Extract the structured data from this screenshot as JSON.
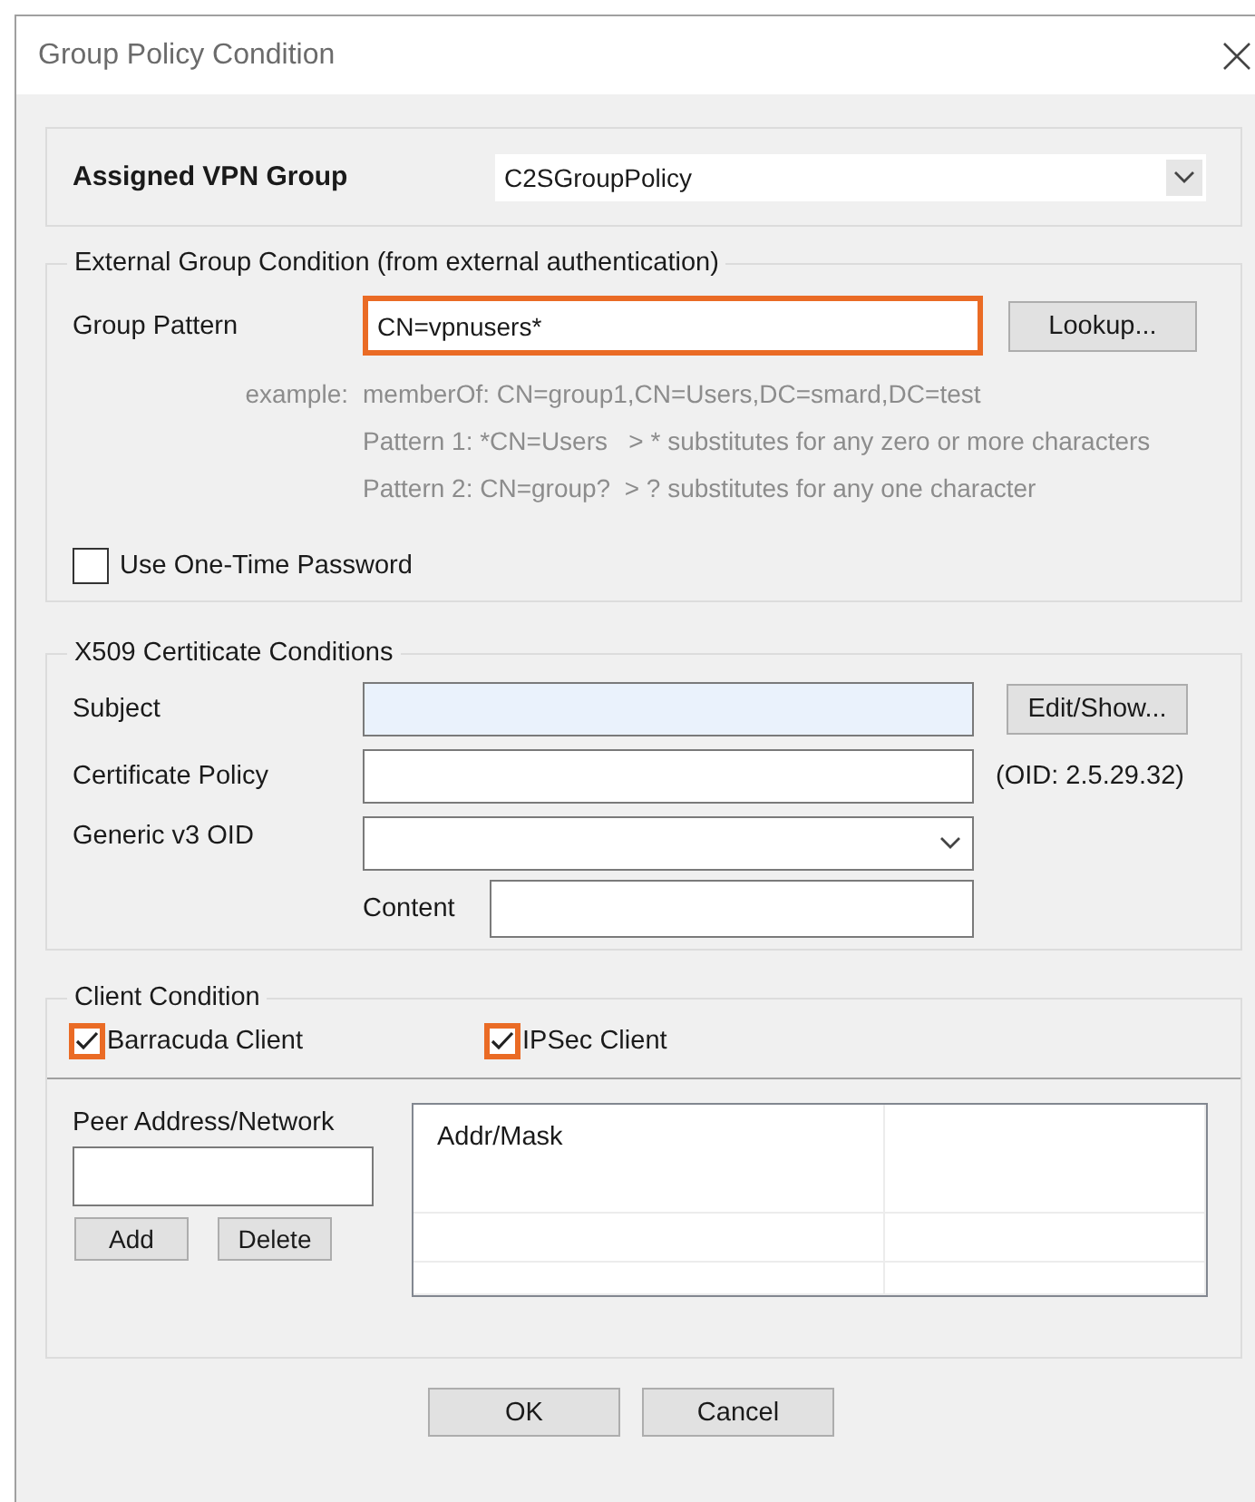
{
  "window": {
    "title": "Group Policy Condition"
  },
  "assigned_vpn_group": {
    "label": "Assigned VPN Group",
    "value": "C2SGroupPolicy"
  },
  "external_group_condition": {
    "title": "External Group Condition (from external authentication)",
    "group_pattern": {
      "label": "Group Pattern",
      "value": "CN=vpnusers*",
      "highlighted": true
    },
    "lookup_button": "Lookup...",
    "example_label": "example:",
    "example_lines": [
      "memberOf: CN=group1,CN=Users,DC=smard,DC=test",
      "Pattern 1: *CN=Users   > * substitutes for any zero or more characters",
      "Pattern 2: CN=group?  > ? substitutes for any one character"
    ],
    "one_time_password": {
      "label": "Use One-Time Password",
      "checked": false
    }
  },
  "x509_certificate_conditions": {
    "title": "X509 Certiticate Conditions",
    "subject": {
      "label": "Subject",
      "focused": true
    },
    "edit_button": "Edit/Show...",
    "certificate_policy": {
      "label": "Certificate Policy"
    },
    "oid_note": "(OID: 2.5.29.32)",
    "generic_v3_oid": {
      "label": "Generic v3 OID"
    },
    "content": {
      "label": "Content"
    }
  },
  "client_condition": {
    "title": "Client Condition",
    "clients": [
      {
        "label": "Barracuda Client",
        "checked": true,
        "highlighted": true
      },
      {
        "label": "IPSec Client",
        "checked": true,
        "highlighted": true
      }
    ],
    "peer_address": {
      "label": "Peer Address/Network"
    },
    "buttons": [
      "Add",
      "Delete"
    ],
    "list": {
      "columns": [
        "Addr/Mask"
      ]
    }
  },
  "buttons": [
    "OK",
    "Cancel"
  ]
}
